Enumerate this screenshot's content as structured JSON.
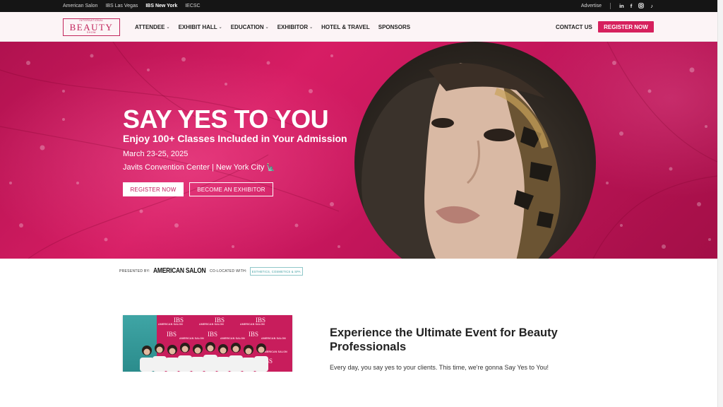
{
  "topbar": {
    "links": [
      "American Salon",
      "IBS Las Vegas",
      "IBS New York",
      "IECSC"
    ],
    "active_index": 2,
    "advertise": "Advertise",
    "social_icons": [
      "linkedin-icon",
      "facebook-icon",
      "instagram-icon",
      "tiktok-icon"
    ]
  },
  "header": {
    "logo": {
      "top": "INTERNATIONAL",
      "main": "BEAUTY",
      "bottom": "SHOW"
    },
    "nav": [
      {
        "label": "ATTENDEE",
        "dropdown": true
      },
      {
        "label": "EXHIBIT HALL",
        "dropdown": true
      },
      {
        "label": "EDUCATION",
        "dropdown": true
      },
      {
        "label": "EXHIBITOR",
        "dropdown": true
      },
      {
        "label": "HOTEL & TRAVEL",
        "dropdown": false
      },
      {
        "label": "SPONSORS",
        "dropdown": false
      }
    ],
    "contact": "CONTACT US",
    "register": "REGISTER NOW"
  },
  "hero": {
    "title": "SAY YES TO YOU",
    "subtitle": "Enjoy 100+ Classes Included in Your Admission",
    "dates": "March 23-25, 2025",
    "venue": "Javits Convention Center | New York City",
    "register_button": "REGISTER NOW",
    "exhibitor_button": "BECOME AN EXHIBITOR",
    "accent_color": "#d6205d"
  },
  "partners": {
    "presented_by": "PRESENTED BY:",
    "presenter": "AMERICAN SALON",
    "colocated_with": "CO-LOCATED WITH:",
    "colocated_logo": "ESTHETICS, COSMETICS & SPA"
  },
  "photo": {
    "backdrop_ibs": "IBS",
    "backdrop_as": "AMERICAN SALON"
  },
  "main": {
    "heading": "Experience the Ultimate Event for Beauty Professionals",
    "body": "Every day, you say yes to your clients. This time, we're gonna Say Yes to You!"
  }
}
